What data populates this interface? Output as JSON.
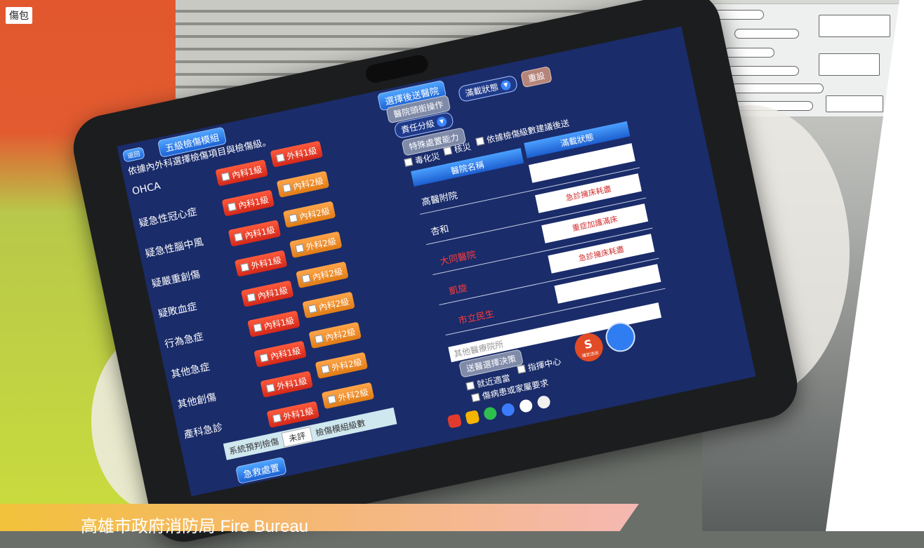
{
  "photo": {
    "bag_label": "傷包",
    "banner_text": "高雄市政府消防局 Fire Bureau"
  },
  "app": {
    "back_button": "返回",
    "title_tab": "五級檢傷模組",
    "instruction": "依據內外科選擇檢傷項目與檢傷級。",
    "categories": [
      {
        "label": "OHCA",
        "left": "內科1級",
        "left_color": "red",
        "right": "外科1級",
        "right_color": "red"
      },
      {
        "label": "疑急性冠心症",
        "left": "內科1級",
        "left_color": "red",
        "right": "內科2級",
        "right_color": "orange"
      },
      {
        "label": "疑急性腦中風",
        "left": "內科1級",
        "left_color": "red",
        "right": "內科2級",
        "right_color": "orange"
      },
      {
        "label": "疑嚴重創傷",
        "left": "外科1級",
        "left_color": "red",
        "right": "外科2級",
        "right_color": "orange"
      },
      {
        "label": "疑敗血症",
        "left": "內科1級",
        "left_color": "red",
        "right": "內科2級",
        "right_color": "orange"
      },
      {
        "label": "行為急症",
        "left": "內科1級",
        "left_color": "red",
        "right": "內科2級",
        "right_color": "orange"
      },
      {
        "label": "其他急症",
        "left": "內科1級",
        "left_color": "red",
        "right": "內科2級",
        "right_color": "orange"
      },
      {
        "label": "其他創傷",
        "left": "外科1級",
        "left_color": "red",
        "right": "外科2級",
        "right_color": "orange"
      },
      {
        "label": "產科急診",
        "left": "外科1級",
        "left_color": "red",
        "right": "外科2級",
        "right_color": "orange"
      }
    ],
    "system_prediction_label": "系統預判檢傷",
    "system_prediction_value": "未評",
    "triage_level_label": "檢傷模組級數",
    "bottom_tab": "急救處置"
  },
  "hospital": {
    "title_tab": "選擇後送醫院",
    "hospital_ops_button": "醫院頭銜操作",
    "load_status_select": "滿載狀態",
    "responsibility_select": "責任分級",
    "reset_button": "重設",
    "special_capability_button": "特殊處置能力",
    "checks": [
      {
        "label": "毒化災",
        "checked": false
      },
      {
        "label": "核災",
        "checked": false
      },
      {
        "label": "依據檢傷級數建議後送",
        "checked": false
      }
    ],
    "table_headers": [
      "醫院名稱",
      "滿載狀態"
    ],
    "rows": [
      {
        "name": "高醫附院",
        "name_color": "#ffffff",
        "status": ""
      },
      {
        "name": "杏和",
        "name_color": "#ffffff",
        "status": "急診擁床耗盡"
      },
      {
        "name": "大同醫院",
        "name_color": "#ff3b3b",
        "status": "重症加護滿床"
      },
      {
        "name": "凱旋",
        "name_color": "#ff3b3b",
        "status": "急診擁床耗盡"
      },
      {
        "name": "市立民生",
        "name_color": "#ff3b3b",
        "status": ""
      }
    ],
    "other_hospital_placeholder": "其他醫療院所",
    "decision_button": "送醫選擇決策",
    "bottom_checks": [
      {
        "label": "就近適當",
        "checked": false
      },
      {
        "label": "指揮中心",
        "checked": false
      },
      {
        "label": "傷病患或家屬要求",
        "checked": false
      }
    ],
    "send_button_label": "S",
    "send_button_sub": "確定送出"
  },
  "colors": {
    "screen_bg": "#1a2c6a",
    "red_button": "#e2351f",
    "orange_button": "#f08c24",
    "accent_blue": "#2f7df0"
  }
}
